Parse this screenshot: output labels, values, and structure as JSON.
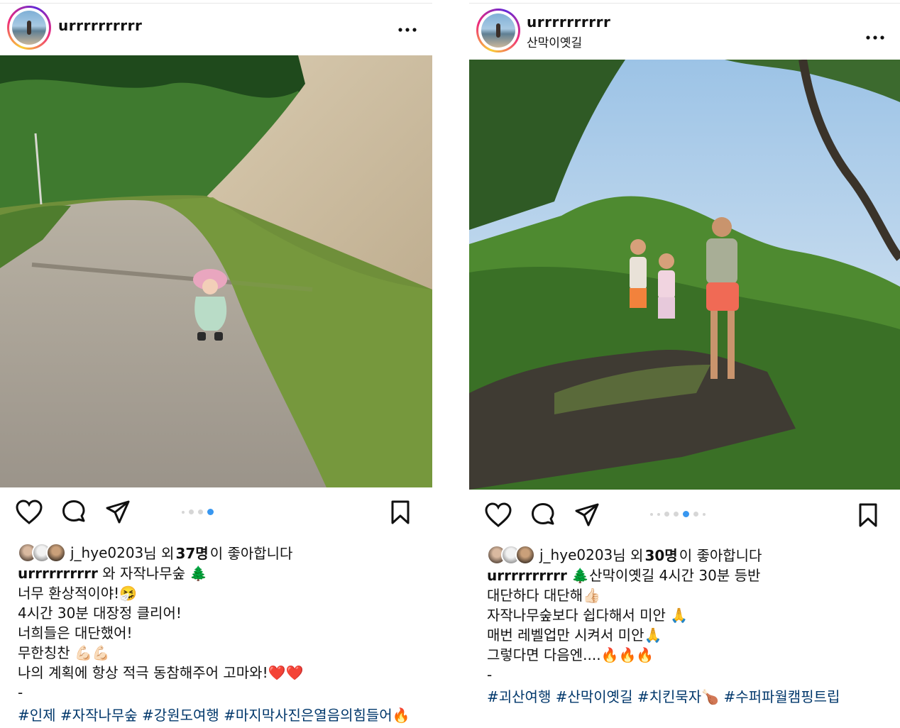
{
  "posts": [
    {
      "username": "urrrrrrrrrr",
      "location": "",
      "more_label": "•••",
      "carousel": {
        "count": 4,
        "active_index": 4
      },
      "likes": {
        "user": "j_hye0203",
        "mid": "님 외 ",
        "count": "37명",
        "suffix": "이 좋아합니다"
      },
      "caption": {
        "username": "urrrrrrrrrr",
        "lines": [
          " 와 자작나무숲 🌲",
          "너무 환상적이야!🤧",
          "4시간 30분 대장정 클리어!",
          "너희들은 대단했어!",
          "무한칭찬 💪🏻💪🏻",
          "나의 계획에 항상 적극 동참해주어 고마와!❤️❤️",
          "-"
        ]
      },
      "hashtags": "#인제 #자작나무숲 #강원도여행 #마지막사진은열음의힘들어🔥"
    },
    {
      "username": "urrrrrrrrrr",
      "location": "산막이옛길",
      "more_label": "•••",
      "carousel": {
        "count": 7,
        "active_index": 5
      },
      "likes": {
        "user": "j_hye0203",
        "mid": "님 외 ",
        "count": "30명",
        "suffix": "이 좋아합니다"
      },
      "caption": {
        "username": "urrrrrrrrrr",
        "lines": [
          " 🌲산막이옛길 4시간 30분 등반",
          "대단하다 대단해👍🏻",
          "자작나무숲보다 쉽다해서 미안 🙏",
          "매번 레벨업만 시켜서 미안🙏",
          "그렇다면 다음엔....🔥🔥🔥",
          "-"
        ]
      },
      "hashtags": "#괴산여행 #산막이옛길 #치킨묵자🍗 #수퍼파월캠핑트립"
    }
  ],
  "icons": [
    "heart-icon",
    "comment-icon",
    "share-icon",
    "bookmark-icon",
    "more-icon"
  ],
  "colors": {
    "hashtag": "#00376b",
    "carousel_active": "#3897f0",
    "carousel_inactive": "#d6d6d6"
  }
}
